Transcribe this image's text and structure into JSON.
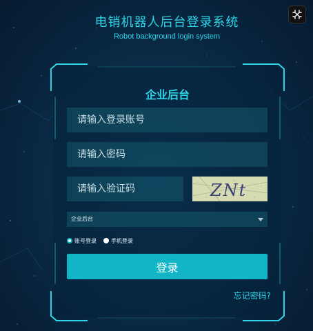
{
  "header": {
    "title": "电销机器人后台登录系统",
    "subtitle": "Robot background login system"
  },
  "toolbar": {
    "fullscreen_icon": "fullscreen-exit-icon"
  },
  "login": {
    "panel_title": "企业后台",
    "account_placeholder": "请输入登录账号",
    "password_placeholder": "请输入密码",
    "captcha_placeholder": "请输入验证码",
    "captcha_text": "ZNt",
    "role_select": {
      "selected": "企业后台"
    },
    "login_modes": [
      {
        "label": "账号登录",
        "checked": true
      },
      {
        "label": "手机登录",
        "checked": false
      }
    ],
    "submit_label": "登录",
    "forgot_label": "忘记密码?"
  },
  "colors": {
    "accent": "#2ed4e8",
    "button": "#12b5c6",
    "background": "#0a2b47"
  }
}
